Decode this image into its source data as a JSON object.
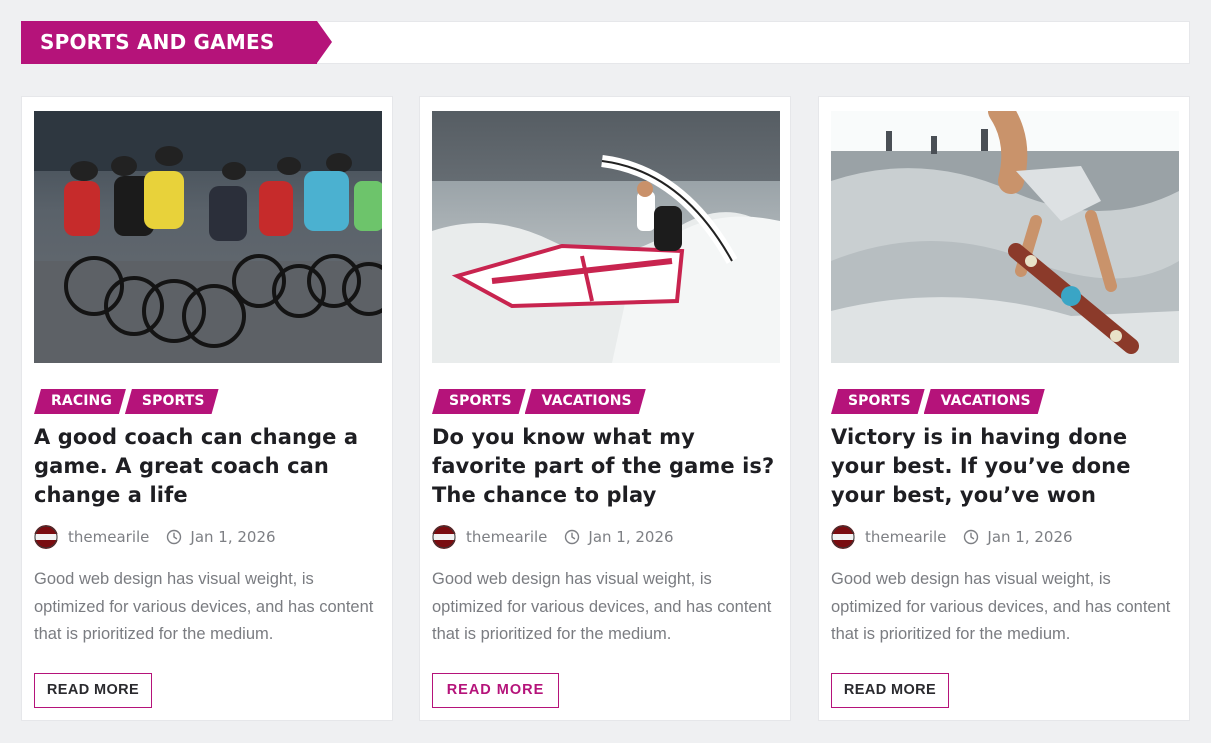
{
  "theme": {
    "accent": "#b5137a"
  },
  "section": {
    "title": "SPORTS AND GAMES"
  },
  "cards": [
    {
      "image_icon": "cycling-race-photo",
      "tags": [
        "RACING",
        "SPORTS"
      ],
      "title": "A good coach can change a game. A great coach can change a life",
      "author": "themearile",
      "date": "Jan 1, 2026",
      "excerpt": "Good web design has visual weight, is optimized for various devices, and has content that is prioritized for the medium.",
      "read_more": "READ MORE"
    },
    {
      "image_icon": "windsurfing-photo",
      "tags": [
        "SPORTS",
        "VACATIONS"
      ],
      "title": "Do you know what my favorite part of the game is? The chance to play",
      "author": "themearile",
      "date": "Jan 1, 2026",
      "excerpt": "Good web design has visual weight, is optimized for various devices, and has content that is prioritized for the medium.",
      "read_more": "READ MORE"
    },
    {
      "image_icon": "skateboarding-photo",
      "tags": [
        "SPORTS",
        "VACATIONS"
      ],
      "title": "Victory is in having done your best. If you’ve done your best, you’ve won",
      "author": "themearile",
      "date": "Jan 1, 2026",
      "excerpt": "Good web design has visual weight, is optimized for various devices, and has content that is prioritized for the medium.",
      "read_more": "READ MORE"
    }
  ]
}
